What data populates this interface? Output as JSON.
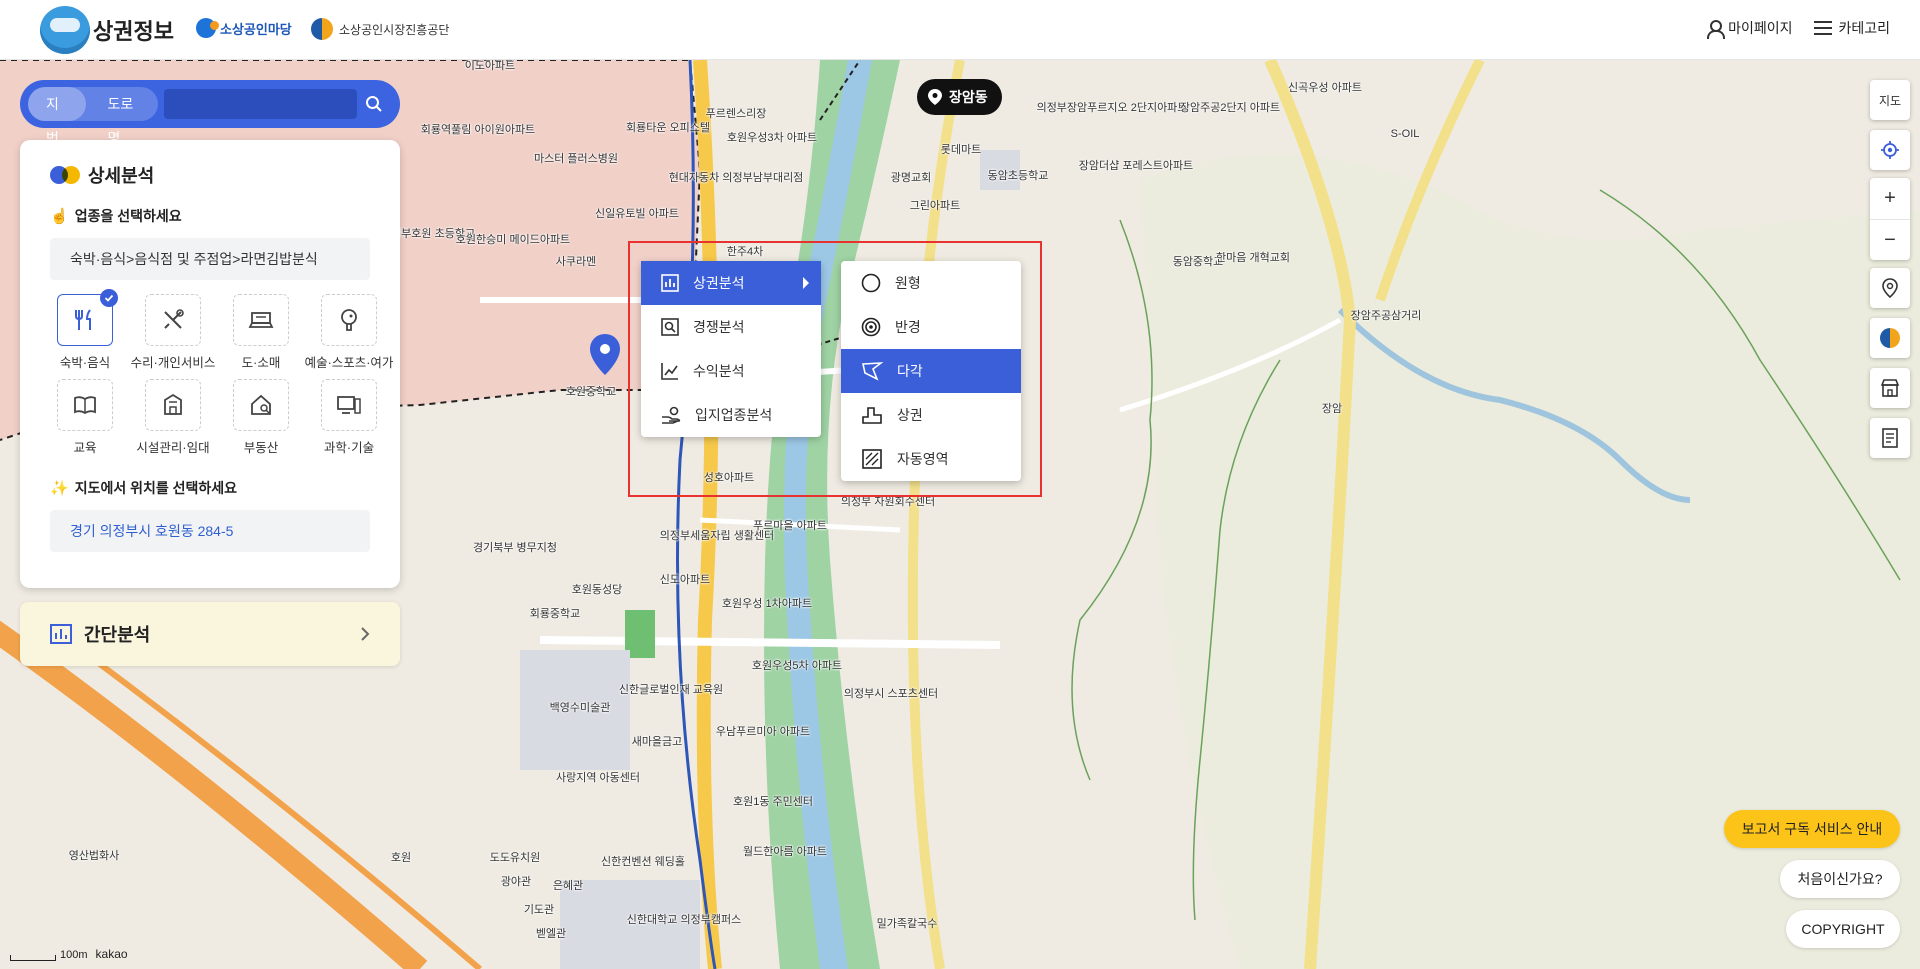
{
  "header": {
    "title": "상권정보",
    "partner1": "소상공인마당",
    "partner2": "소상공인시장진흥공단",
    "mypage": "마이페이지",
    "category": "카테고리"
  },
  "search": {
    "tab_jibun": "지번",
    "tab_road": "도로명",
    "value": ""
  },
  "panel": {
    "title": "상세분석",
    "step1": "업종을 선택하세요",
    "step1_emoji": "☝️",
    "selected_category": "숙박·음식>음식점 및 주점업>라면김밥분식",
    "categories": [
      {
        "label": "숙박·음식",
        "icon": "fork-knife-icon"
      },
      {
        "label": "수리·개인서비스",
        "icon": "tools-icon"
      },
      {
        "label": "도·소매",
        "icon": "register-icon"
      },
      {
        "label": "예술·스포츠·여가",
        "icon": "ping-pong-icon"
      },
      {
        "label": "교육",
        "icon": "book-icon"
      },
      {
        "label": "시설관리·임대",
        "icon": "building-icon"
      },
      {
        "label": "부동산",
        "icon": "house-icon"
      },
      {
        "label": "과학·기술",
        "icon": "computer-icon"
      }
    ],
    "selected_index": 0,
    "step2": "지도에서 위치를 선택하세요",
    "step2_emoji": "✨",
    "address": "경기 의정부시 호원동 284-5"
  },
  "simple": {
    "title": "간단분석"
  },
  "place_pill": "장암동",
  "menu_main": [
    {
      "label": "상권분석",
      "icon": "bar-chart-icon",
      "active": true
    },
    {
      "label": "경쟁분석",
      "icon": "magnifier-doc-icon",
      "active": false
    },
    {
      "label": "수익분석",
      "icon": "line-chart-icon",
      "active": false
    },
    {
      "label": "입지업종분석",
      "icon": "hand-coins-icon",
      "active": false
    }
  ],
  "menu_sub": [
    {
      "label": "원형",
      "icon": "circle-icon",
      "active": false
    },
    {
      "label": "반경",
      "icon": "target-icon",
      "active": false
    },
    {
      "label": "다각",
      "icon": "polygon-icon",
      "active": true
    },
    {
      "label": "상권",
      "icon": "district-icon",
      "active": false
    },
    {
      "label": "자동영역",
      "icon": "auto-area-icon",
      "active": false
    }
  ],
  "right_controls": {
    "map_label": "지도",
    "zoom_in": "+",
    "zoom_out": "−"
  },
  "bottom_buttons": {
    "subscribe": "보고서 구독 서비스 안내",
    "first_time": "처음이신가요?",
    "copyright": "COPYRIGHT"
  },
  "scale": {
    "distance": "100m",
    "brand": "kakao"
  },
  "map_labels": [
    "이도아파트",
    "회룡역풀림 아이원아파트",
    "마스터 플러스병원",
    "회룡타운 오피스텔",
    "푸르렌스리장",
    "호원우성3차 아파트",
    "롯데마트",
    "장암동",
    "의정부장암푸르지오 2단지아파트",
    "장암주공2단지 아파트",
    "신곡우성 아파트",
    "S-OIL",
    "현대자동차 의정부남부대리점",
    "광명교회",
    "동암초등학교",
    "장암더샵 포레스트아파트",
    "신일유토빌 아파트",
    "의정부호원 초등학교",
    "호원한승미 메이드아파트",
    "사쿠라멘",
    "한주4차",
    "그린아파트",
    "동암중학교",
    "한마음 개혁교회",
    "장암주공삼거리",
    "호원중학교",
    "성호아파트",
    "의정부 자원회수센터",
    "의정부세움자립 생활센터",
    "푸르마을 아파트",
    "경기북부 병무지청",
    "호원동성당",
    "신도아파트",
    "회룡중학교",
    "호원우성 1차아파트",
    "호원우성5차 아파트",
    "의정부시 스포츠센터",
    "백영수미술관",
    "신한글로벌인재 교육원",
    "새마을금고",
    "우남푸르미아 아파트",
    "사랑지역 아동센터",
    "호원1동 주민센터",
    "월드한아름 아파트",
    "영산법화사",
    "호원",
    "도도유치원",
    "광야관",
    "은혜관",
    "신한컨벤션 웨딩홀",
    "기도관",
    "벧엘관",
    "신한대학교 의정부캠퍼스",
    "밀가족칼국수",
    "장암"
  ]
}
